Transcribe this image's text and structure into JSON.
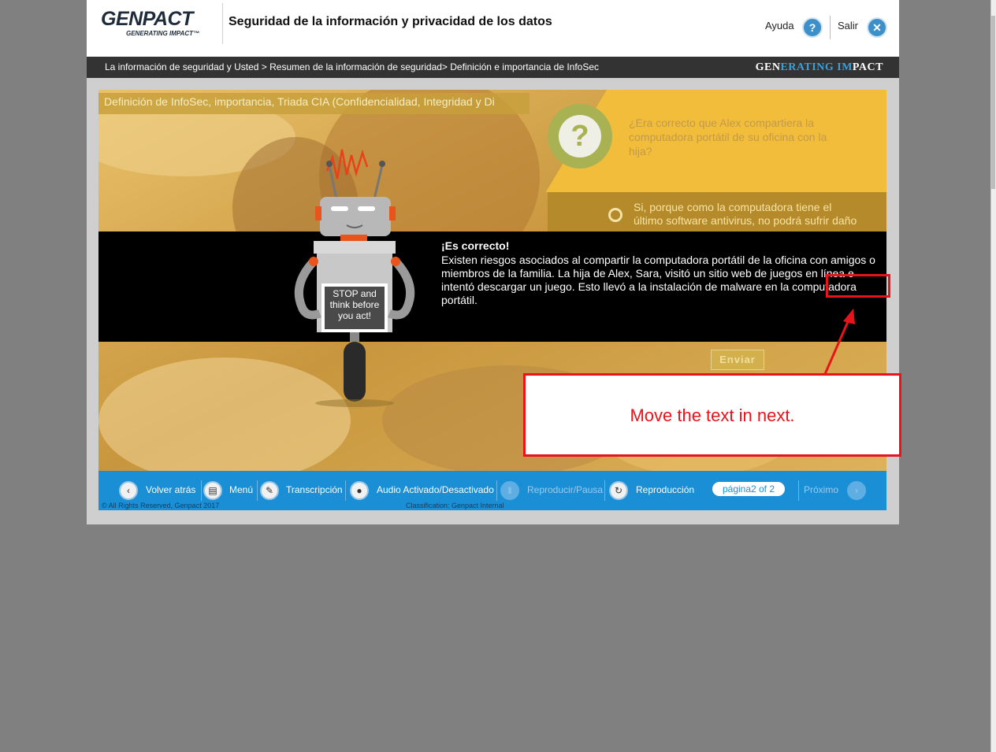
{
  "header": {
    "logo_text": "GENPACT",
    "logo_tagline": "GENERATING IMPACT™",
    "course_title": "Seguridad de la información y privacidad de los datos",
    "help_label": "Ayuda",
    "exit_label": "Salir",
    "help_icon": "?",
    "exit_icon": "✕"
  },
  "breadcrumb": {
    "text": "La información de seguridad y Usted > Resumen de la información de seguridad> Definición e importancia de InfoSec",
    "brand_part1": "GEN",
    "brand_part2": "ERATING ",
    "brand_part3": "IM",
    "brand_part4": "PACT"
  },
  "slide": {
    "title": "Definición de InfoSec, importancia, Triada CIA (Confidencialidad, Integridad y Di",
    "question_icon": "?",
    "question": "¿Era correcto que Alex compartiera la computadora portátil de su oficina con la hija?",
    "option_text": "Si, porque como la computadora tiene el último software antivirus, no podrá sufrir daño",
    "submit_label": "Enviar",
    "robot_sign": "STOP and think before you act!"
  },
  "feedback": {
    "title": "¡Es correcto!",
    "body": "Existen riesgos asociados al compartir la computadora portátil de la oficina con amigos o miembros de la familia. La hija de Alex, Sara, visitó un sitio web de juegos en línea e intentó descargar un juego. Esto llevó a la instalación de malware en la computadora portátil."
  },
  "nav": {
    "back_label": "Volver atrás",
    "menu_label": "Menú",
    "transcript_label": "Transcripción",
    "audio_label": "Audio Activado/Desactivado",
    "play_pause_label": "Reproducir/Pausa",
    "replay_label": "Reproducción",
    "page_indicator": "página2 of 2",
    "next_label": "Próximo",
    "copyright": "© All Rights Reserved, Genpact 2017",
    "classification": "Classification: Genpact Internal"
  },
  "annotation": {
    "note": "Move the text in next.",
    "highlight_color": "#e8141b"
  },
  "colors": {
    "accent_blue": "#1b8fd6",
    "slide_yellow": "#f3bd3c",
    "feedback_bg": "#000000"
  }
}
